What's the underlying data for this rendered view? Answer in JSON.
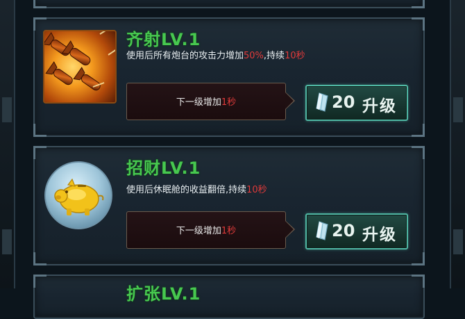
{
  "skills": [
    {
      "title": "齐射LV.1",
      "desc_pre": "使用后所有炮台的攻击力增加",
      "desc_highlight": "50%",
      "desc_mid": ",持续",
      "desc_highlight2": "10秒",
      "next_pre": "下一级增加",
      "next_highlight": "1秒",
      "cost": "20",
      "upgrade_label": "升级",
      "icon": "rocket-salvo-icon"
    },
    {
      "title": "招财LV.1",
      "desc_pre": "使用后休眠舱的收益翻倍,持续",
      "desc_highlight": "10秒",
      "next_pre": "下一级增加",
      "next_highlight": "1秒",
      "cost": "20",
      "upgrade_label": "升级",
      "icon": "golden-piggy-bank-icon"
    },
    {
      "title": "扩张LV.1"
    }
  ],
  "colors": {
    "title_green": "#47c84f",
    "highlight_red": "#e23a3a",
    "button_border": "#4fb7a3"
  }
}
